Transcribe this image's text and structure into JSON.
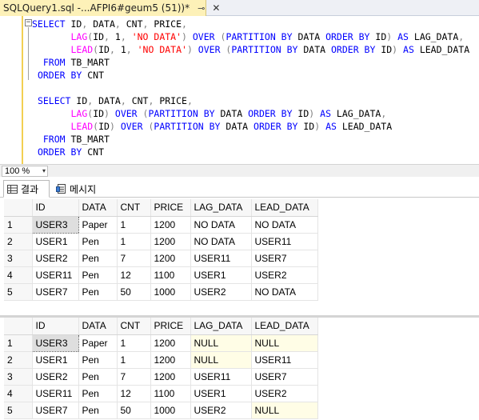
{
  "tab": {
    "title": "SQLQuery1.sql -...AFPI6#geum5 (51))*",
    "pin_glyph": "⊸",
    "close_glyph": "✕"
  },
  "editor": {
    "outline_toggle": "−",
    "query1": [
      [
        [
          "kw",
          "SELECT "
        ],
        [
          "plain",
          "ID"
        ],
        [
          "op",
          ", "
        ],
        [
          "plain",
          "DATA"
        ],
        [
          "op",
          ", "
        ],
        [
          "plain",
          "CNT"
        ],
        [
          "op",
          ", "
        ],
        [
          "plain",
          "PRICE"
        ],
        [
          "op",
          ","
        ]
      ],
      [
        [
          "plain",
          "       "
        ],
        [
          "fn",
          "LAG"
        ],
        [
          "op",
          "("
        ],
        [
          "plain",
          "ID"
        ],
        [
          "op",
          ", "
        ],
        [
          "plain",
          "1"
        ],
        [
          "op",
          ", "
        ],
        [
          "str",
          "'NO DATA'"
        ],
        [
          "op",
          ") "
        ],
        [
          "kw",
          "OVER "
        ],
        [
          "op",
          "("
        ],
        [
          "kw",
          "PARTITION BY "
        ],
        [
          "plain",
          "DATA "
        ],
        [
          "kw",
          "ORDER BY "
        ],
        [
          "plain",
          "ID"
        ],
        [
          "op",
          ") "
        ],
        [
          "kw",
          "AS "
        ],
        [
          "plain",
          "LAG_DATA"
        ],
        [
          "op",
          ","
        ]
      ],
      [
        [
          "plain",
          "       "
        ],
        [
          "fn",
          "LEAD"
        ],
        [
          "op",
          "("
        ],
        [
          "plain",
          "ID"
        ],
        [
          "op",
          ", "
        ],
        [
          "plain",
          "1"
        ],
        [
          "op",
          ", "
        ],
        [
          "str",
          "'NO DATA'"
        ],
        [
          "op",
          ") "
        ],
        [
          "kw",
          "OVER "
        ],
        [
          "op",
          "("
        ],
        [
          "kw",
          "PARTITION BY "
        ],
        [
          "plain",
          "DATA "
        ],
        [
          "kw",
          "ORDER BY "
        ],
        [
          "plain",
          "ID"
        ],
        [
          "op",
          ") "
        ],
        [
          "kw",
          "AS "
        ],
        [
          "plain",
          "LEAD_DATA"
        ]
      ],
      [
        [
          "plain",
          "  "
        ],
        [
          "kw",
          "FROM "
        ],
        [
          "plain",
          "TB_MART"
        ]
      ],
      [
        [
          "plain",
          " "
        ],
        [
          "kw",
          "ORDER BY "
        ],
        [
          "plain",
          "CNT"
        ]
      ]
    ],
    "query2": [
      [
        [
          "plain",
          " "
        ],
        [
          "kw",
          "SELECT "
        ],
        [
          "plain",
          "ID"
        ],
        [
          "op",
          ", "
        ],
        [
          "plain",
          "DATA"
        ],
        [
          "op",
          ", "
        ],
        [
          "plain",
          "CNT"
        ],
        [
          "op",
          ", "
        ],
        [
          "plain",
          "PRICE"
        ],
        [
          "op",
          ","
        ]
      ],
      [
        [
          "plain",
          "       "
        ],
        [
          "fn",
          "LAG"
        ],
        [
          "op",
          "("
        ],
        [
          "plain",
          "ID"
        ],
        [
          "op",
          ") "
        ],
        [
          "kw",
          "OVER "
        ],
        [
          "op",
          "("
        ],
        [
          "kw",
          "PARTITION BY "
        ],
        [
          "plain",
          "DATA "
        ],
        [
          "kw",
          "ORDER BY "
        ],
        [
          "plain",
          "ID"
        ],
        [
          "op",
          ") "
        ],
        [
          "kw",
          "AS "
        ],
        [
          "plain",
          "LAG_DATA"
        ],
        [
          "op",
          ","
        ]
      ],
      [
        [
          "plain",
          "       "
        ],
        [
          "fn",
          "LEAD"
        ],
        [
          "op",
          "("
        ],
        [
          "plain",
          "ID"
        ],
        [
          "op",
          ") "
        ],
        [
          "kw",
          "OVER "
        ],
        [
          "op",
          "("
        ],
        [
          "kw",
          "PARTITION BY "
        ],
        [
          "plain",
          "DATA "
        ],
        [
          "kw",
          "ORDER BY "
        ],
        [
          "plain",
          "ID"
        ],
        [
          "op",
          ") "
        ],
        [
          "kw",
          "AS "
        ],
        [
          "plain",
          "LEAD_DATA"
        ]
      ],
      [
        [
          "plain",
          "  "
        ],
        [
          "kw",
          "FROM "
        ],
        [
          "plain",
          "TB_MART"
        ]
      ],
      [
        [
          "plain",
          " "
        ],
        [
          "kw",
          "ORDER BY "
        ],
        [
          "plain",
          "CNT"
        ]
      ]
    ]
  },
  "zoom": {
    "value": "100 %",
    "arrow": "▾"
  },
  "result_tabs": {
    "results_label": "결과",
    "messages_label": "메시지"
  },
  "grid1": {
    "columns": [
      "ID",
      "DATA",
      "CNT",
      "PRICE",
      "LAG_DATA",
      "LEAD_DATA"
    ],
    "rows": [
      [
        "1",
        "USER3",
        "Paper",
        "1",
        "1200",
        "NO DATA",
        "NO DATA"
      ],
      [
        "2",
        "USER1",
        "Pen",
        "1",
        "1200",
        "NO DATA",
        "USER11"
      ],
      [
        "3",
        "USER2",
        "Pen",
        "7",
        "1200",
        "USER11",
        "USER7"
      ],
      [
        "4",
        "USER11",
        "Pen",
        "12",
        "1100",
        "USER1",
        "USER2"
      ],
      [
        "5",
        "USER7",
        "Pen",
        "50",
        "1000",
        "USER2",
        "NO DATA"
      ]
    ]
  },
  "grid2": {
    "columns": [
      "ID",
      "DATA",
      "CNT",
      "PRICE",
      "LAG_DATA",
      "LEAD_DATA"
    ],
    "rows": [
      [
        "1",
        "USER3",
        "Paper",
        "1",
        "1200",
        "NULL",
        "NULL"
      ],
      [
        "2",
        "USER1",
        "Pen",
        "1",
        "1200",
        "NULL",
        "USER11"
      ],
      [
        "3",
        "USER2",
        "Pen",
        "7",
        "1200",
        "USER11",
        "USER7"
      ],
      [
        "4",
        "USER11",
        "Pen",
        "12",
        "1100",
        "USER1",
        "USER2"
      ],
      [
        "5",
        "USER7",
        "Pen",
        "50",
        "1000",
        "USER2",
        "NULL"
      ]
    ]
  },
  "colors": {
    "tab_active": "#fdf1b8",
    "margin": "#f2cf52",
    "keyword": "#0000ff",
    "function": "#ff00ff",
    "string": "#ff0000",
    "null_cell": "#fffde6"
  }
}
